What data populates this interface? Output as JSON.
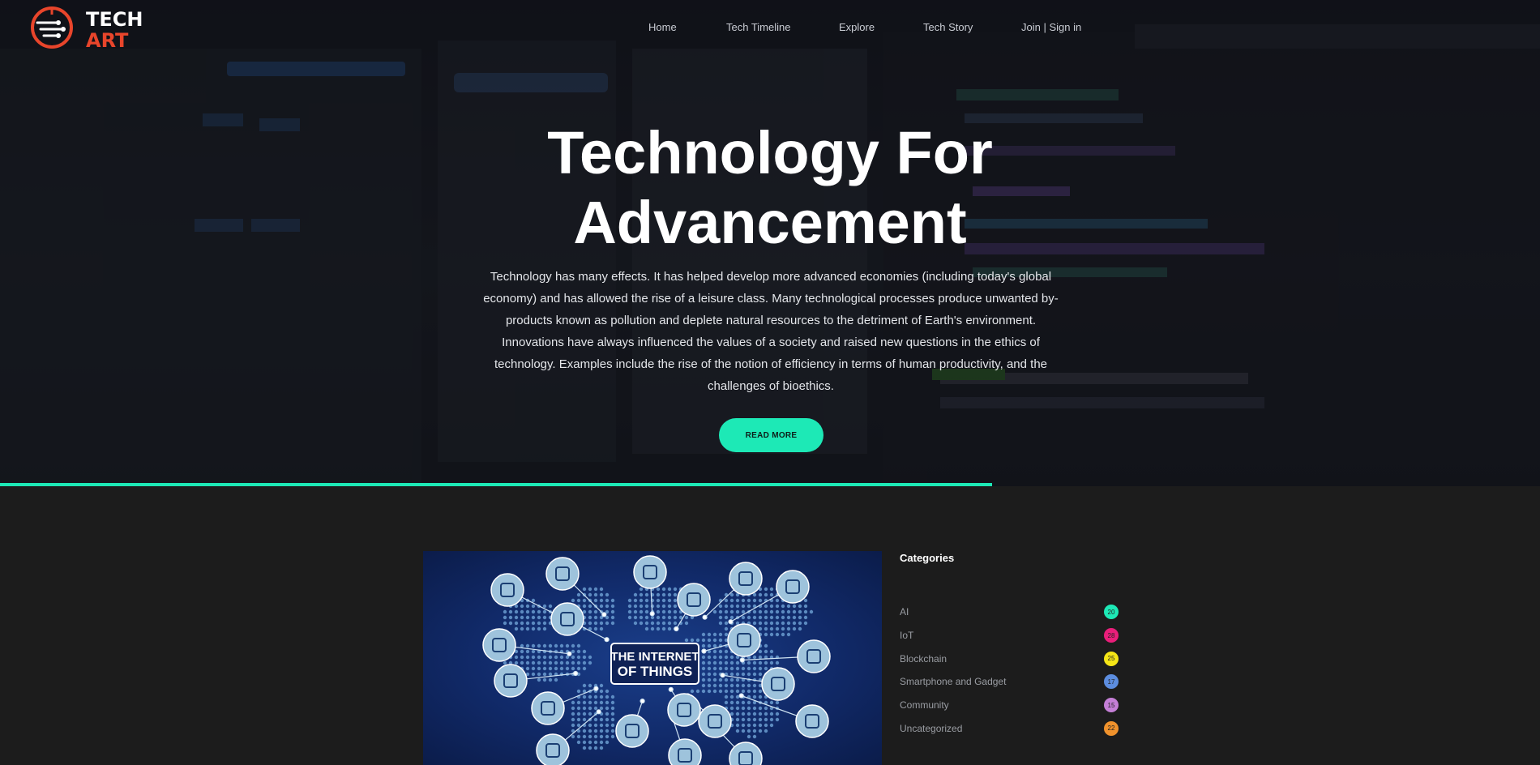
{
  "brand": {
    "line1": "TECH",
    "line2": "ART",
    "accent": "#e8452b"
  },
  "nav": {
    "items": [
      {
        "label": "Home"
      },
      {
        "label": "Tech Timeline"
      },
      {
        "label": "Explore"
      },
      {
        "label": "Tech Story"
      },
      {
        "label": "Join | Sign in"
      }
    ]
  },
  "hero": {
    "title_line1": "Technology For",
    "title_line2": "Advancement",
    "body": "Technology has many effects. It has helped develop more advanced economies (including today's global economy) and has allowed the rise of a leisure class. Many technological processes produce unwanted by-products known as pollution and deplete natural resources to the detriment of Earth's environment. Innovations have always influenced the values of a society and raised new questions in the ethics of technology. Examples include the rise of the notion of efficiency in terms of human productivity, and the challenges of bioethics.",
    "cta": "READ MORE",
    "accent": "#1de9b6",
    "progress": 0.644
  },
  "featured": {
    "line1": "THE INTERNET",
    "line2": "OF THINGS",
    "icons": [
      "plug-icon",
      "router-icon",
      "airplane-icon",
      "mobile-icon",
      "phone-icon",
      "handshake-icon",
      "laptop-icon",
      "envelope-icon",
      "smartphone-icon",
      "user-icon",
      "location-pin-icon",
      "ring-icon",
      "robot-arm-icon",
      "chat-icon",
      "server-icon",
      "people-icon",
      "thumbs-up-icon",
      "vr-headset-icon",
      "shield-icon",
      "network-icon"
    ]
  },
  "sidebar": {
    "title": "Categories",
    "categories": [
      {
        "label": "AI",
        "count": "20",
        "color": "#1de9b6"
      },
      {
        "label": "IoT",
        "count": "28",
        "color": "#e91e7a"
      },
      {
        "label": "Blockchain",
        "count": "25",
        "color": "#f5e516"
      },
      {
        "label": "Smartphone and Gadget",
        "count": "17",
        "color": "#5c8ddf"
      },
      {
        "label": "Community",
        "count": "15",
        "color": "#c47fd6"
      },
      {
        "label": "Uncategorized",
        "count": "22",
        "color": "#f0922c"
      }
    ]
  }
}
